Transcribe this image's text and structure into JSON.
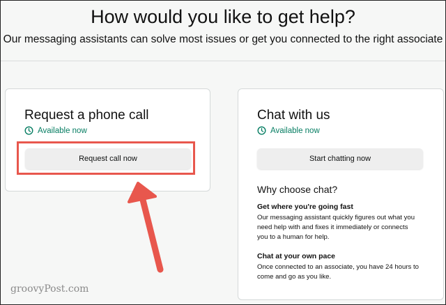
{
  "header": {
    "title": "How would you like to get help?",
    "subtitle": "Our messaging assistants can solve most issues or get you connected to the right associate"
  },
  "phone_card": {
    "title": "Request a phone call",
    "availability": "Available now",
    "button_label": "Request call now"
  },
  "chat_card": {
    "title": "Chat with us",
    "availability": "Available now",
    "button_label": "Start chatting now",
    "why_title": "Why choose chat?",
    "features": [
      {
        "title": "Get where you're going fast",
        "lines": [
          "Our messaging assistant quickly figures out what you",
          "need help with and fixes it immediately or connects",
          "you to a human for help."
        ]
      },
      {
        "title": "Chat at your own pace",
        "lines": [
          "Once connected to an associate, you have 24 hours to",
          "come and go as you like."
        ]
      }
    ]
  },
  "watermark": "groovyPost.com",
  "colors": {
    "available_green": "#067d62",
    "highlight_red": "#e8574d",
    "button_gray": "#eeeeee"
  },
  "icons": {
    "availability": "clock-icon",
    "annotation": "arrow-pointer"
  }
}
